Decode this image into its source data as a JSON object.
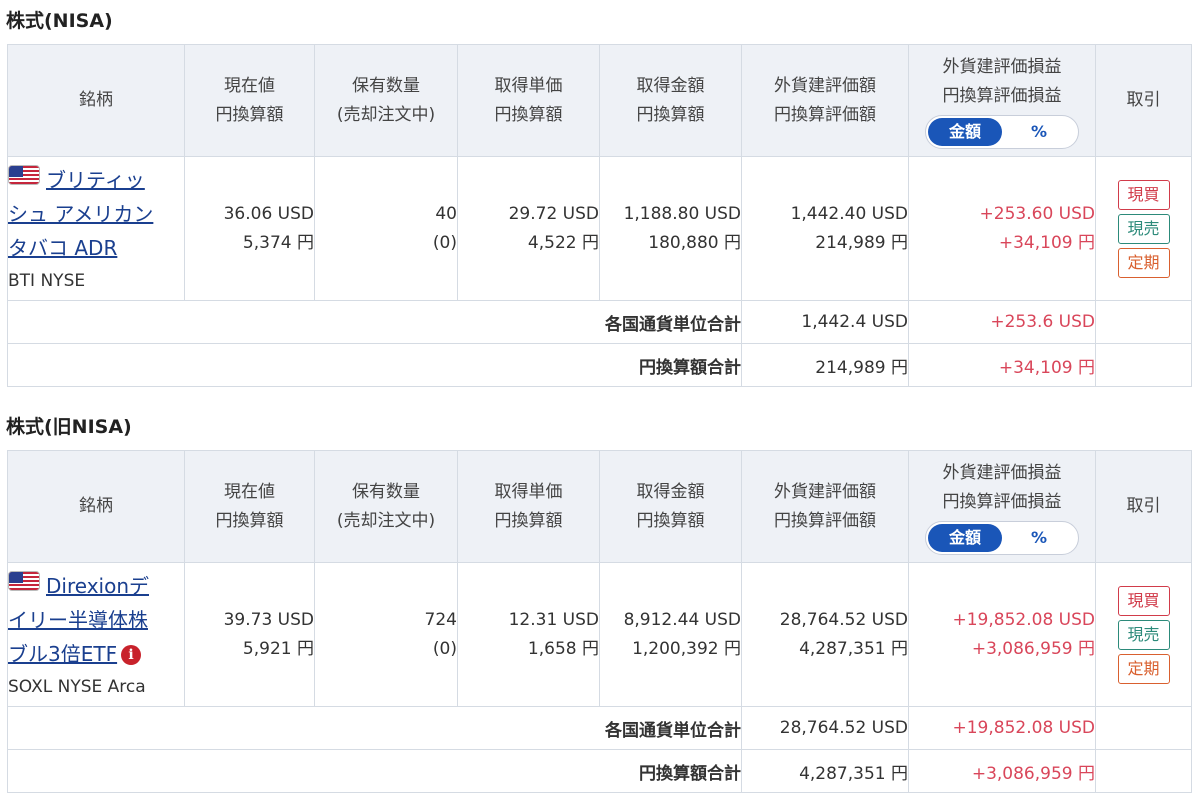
{
  "sections": [
    {
      "title": "株式(NISA)",
      "headers": {
        "name": "銘柄",
        "current": [
          "現在値",
          "円換算額"
        ],
        "quantity": [
          "保有数量",
          "(売却注文中)"
        ],
        "unit_cost": [
          "取得単価",
          "円換算額"
        ],
        "total_cost": [
          "取得金額",
          "円換算額"
        ],
        "valuation": [
          "外貨建評価額",
          "円換算評価額"
        ],
        "profit": [
          "外貨建評価損益",
          "円換算評価損益"
        ],
        "trade": "取引"
      },
      "toggle": {
        "amount": "金額",
        "percent": "%"
      },
      "holding": {
        "name_lines": [
          "ブリティッ",
          "シュ アメリカン",
          "タバコ ADR"
        ],
        "ticker": "BTI NYSE",
        "current_usd": "36.06 USD",
        "current_jpy": "5,374 円",
        "quantity": "40",
        "quantity_pending": "(0)",
        "unit_cost_usd": "29.72 USD",
        "unit_cost_jpy": "4,522 円",
        "total_cost_usd": "1,188.80 USD",
        "total_cost_jpy": "180,880 円",
        "valuation_usd": "1,442.40 USD",
        "valuation_jpy": "214,989 円",
        "profit_usd": "+253.60 USD",
        "profit_jpy": "+34,109 円",
        "has_info": false
      },
      "trade_buttons": {
        "buy": "現買",
        "sell": "現売",
        "periodic": "定期"
      },
      "totals": {
        "currency_label": "各国通貨単位合計",
        "currency_value": "1,442.4 USD",
        "currency_profit": "+253.6 USD",
        "jpy_label": "円換算額合計",
        "jpy_value": "214,989 円",
        "jpy_profit": "+34,109 円"
      }
    },
    {
      "title": "株式(旧NISA)",
      "headers": {
        "name": "銘柄",
        "current": [
          "現在値",
          "円換算額"
        ],
        "quantity": [
          "保有数量",
          "(売却注文中)"
        ],
        "unit_cost": [
          "取得単価",
          "円換算額"
        ],
        "total_cost": [
          "取得金額",
          "円換算額"
        ],
        "valuation": [
          "外貨建評価額",
          "円換算評価額"
        ],
        "profit": [
          "外貨建評価損益",
          "円換算評価損益"
        ],
        "trade": "取引"
      },
      "toggle": {
        "amount": "金額",
        "percent": "%"
      },
      "holding": {
        "name_lines": [
          "Direxionデ",
          "イリー半導体株",
          "ブル3倍ETF"
        ],
        "ticker": "SOXL NYSE Arca",
        "info_glyph": "i",
        "current_usd": "39.73 USD",
        "current_jpy": "5,921 円",
        "quantity": "724",
        "quantity_pending": "(0)",
        "unit_cost_usd": "12.31 USD",
        "unit_cost_jpy": "1,658 円",
        "total_cost_usd": "8,912.44 USD",
        "total_cost_jpy": "1,200,392 円",
        "valuation_usd": "28,764.52 USD",
        "valuation_jpy": "4,287,351 円",
        "profit_usd": "+19,852.08 USD",
        "profit_jpy": "+3,086,959 円",
        "has_info": true
      },
      "trade_buttons": {
        "buy": "現買",
        "sell": "現売",
        "periodic": "定期"
      },
      "totals": {
        "currency_label": "各国通貨単位合計",
        "currency_value": "28,764.52 USD",
        "currency_profit": "+19,852.08 USD",
        "jpy_label": "円換算額合計",
        "jpy_value": "4,287,351 円",
        "jpy_profit": "+3,086,959 円"
      }
    }
  ],
  "icons": {
    "flag": "us-flag-icon",
    "info": "info-icon"
  },
  "colors": {
    "profit": "#d9465a",
    "accent": "#1a56b8",
    "link": "#1a3f8f"
  }
}
